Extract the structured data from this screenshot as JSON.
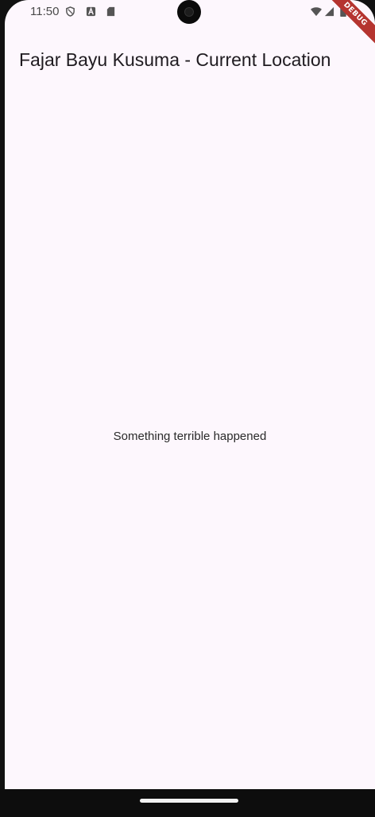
{
  "status_bar": {
    "time": "11:50",
    "left_icons": [
      "shield-icon",
      "a-badge-icon",
      "sd-card-icon"
    ],
    "right_icons": [
      "wifi-icon",
      "signal-icon",
      "battery-icon"
    ]
  },
  "debug_banner": {
    "label": "DEBUG"
  },
  "app_bar": {
    "title": "Fajar Bayu Kusuma - Current Location"
  },
  "body": {
    "message": "Something terrible happened"
  },
  "colors": {
    "background": "#fdf7fd",
    "text": "#1f1b20",
    "debug_banner": "#b5342f"
  }
}
